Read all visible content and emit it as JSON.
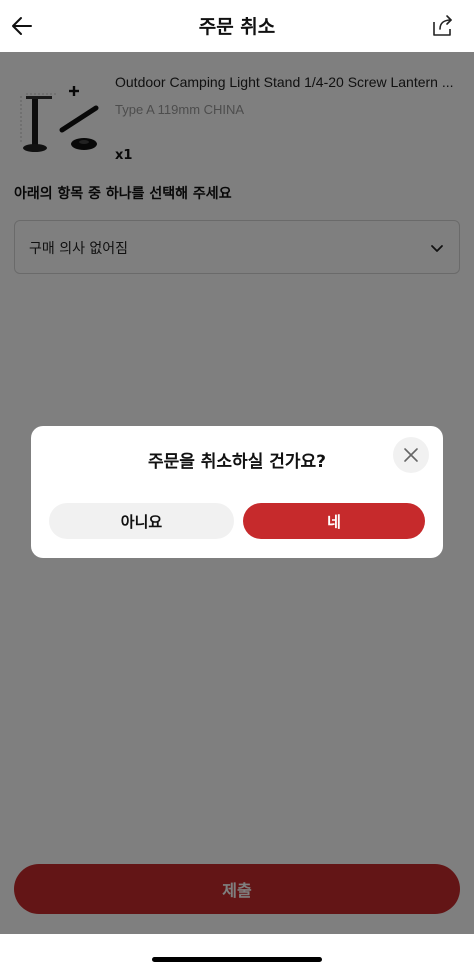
{
  "header": {
    "title": "주문 취소",
    "back_icon": "arrow-left-icon",
    "share_icon": "share-icon"
  },
  "product": {
    "name": "Outdoor Camping Light Stand 1/4-20 Screw Lantern ...",
    "variant": "Type A 119mm CHINA",
    "quantity": "x1"
  },
  "reason": {
    "label": "아래의 항목 중 하나를 선택해 주세요",
    "selected": "구매 의사 없어짐",
    "icon": "chevron-down-icon"
  },
  "submit_label": "제출",
  "dialog": {
    "title": "주문을 취소하실 건가요?",
    "no_label": "아니요",
    "yes_label": "네",
    "close_icon": "close-icon"
  },
  "colors": {
    "accent": "#c62a2c",
    "overlay": "rgba(0,0,0,0.5)",
    "secondary_button": "#f1f1f1"
  }
}
